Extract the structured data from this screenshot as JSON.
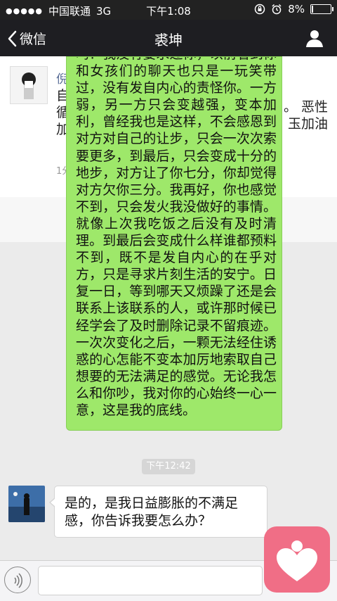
{
  "status_bar": {
    "carrier": "中国联通",
    "network": "3G",
    "time": "下午1:08",
    "battery": "8%",
    "battery_level": 0.08
  },
  "nav": {
    "back_label": "微信",
    "title": "裘坤"
  },
  "moments_card": {
    "author": "倪",
    "text_lines": [
      "自",
      "循",
      "加"
    ],
    "right_text_lines": [
      "。 恶性",
      "玉加油"
    ],
    "time": "1分"
  },
  "messages": [
    {
      "direction": "outgoing",
      "text": "吗？我没有要求过你，以前看到你和女孩们的聊天也只是一玩笑带过，没有发自内心的责怪你。一方弱，另一方只会变越强，变本加利，曾经我也是这样，不会感恩到对方对自己的让步，只会一次次索要更多，到最后，只会变成十分的地步，对方让了你七分，你却觉得对方欠你三分。我再好，你也感觉不到，只会发火我没做好的事情。就像上次我吃饭之后没有及时清理。到最后会变成什么样谁都预料不到，既不是发自内心的在乎对方，只是寻求片刻生活的安宁。日复一日，等到哪天又烦躁了还是会联系上该联系的人，或许那时候已经学会了及时删除记录不留痕迹。一次次变化之后，一颗无法经住诱惑的心怎能不变本加厉地索取自己想要的无法满足的感觉。无论我怎么和你吵，我对你的心始终一心一意，这是我的底线。"
    },
    {
      "direction": "timestamp",
      "text": "下午12:42"
    },
    {
      "direction": "incoming",
      "text": "是的，是我日益膨胀的不满足感，你告诉我要怎么办？"
    }
  ],
  "colors": {
    "outgoing_bubble": "#9ee86a",
    "nav_background": "#1e1e22",
    "watermark": "#f06e86"
  }
}
